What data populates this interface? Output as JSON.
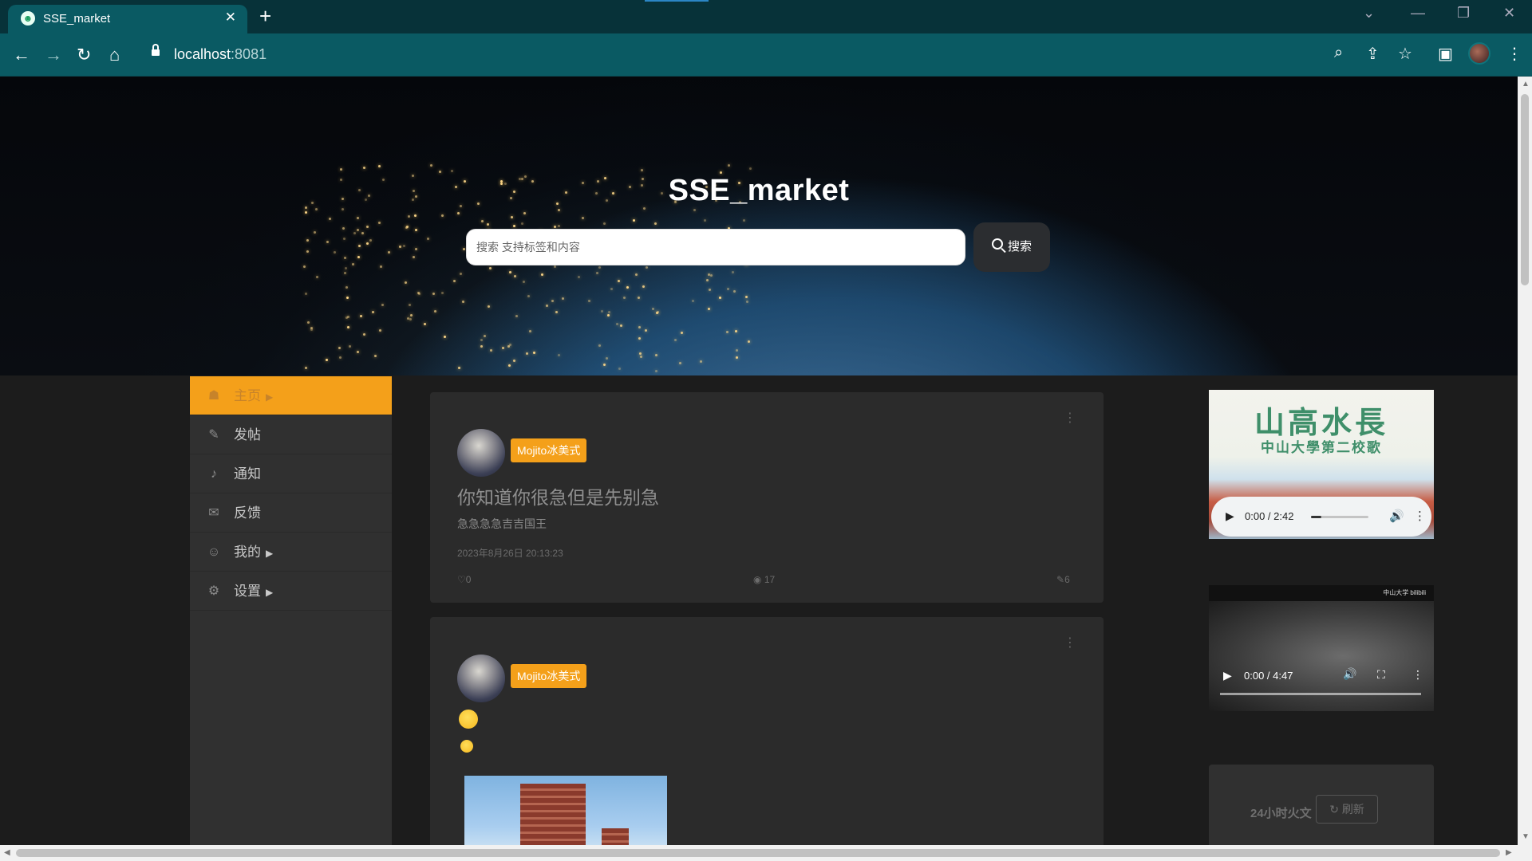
{
  "browser": {
    "tab_title": "SSE_market",
    "new_tab_label": "+",
    "close_tab_label": "✕",
    "url_host": "localhost",
    "url_port": ":8081",
    "icons": [
      "back-arrow-icon",
      "forward-arrow-icon",
      "reload-icon",
      "home-icon",
      "lock-icon",
      "zoom-icon",
      "share-icon",
      "star-icon",
      "sidepanel-icon",
      "profile-avatar",
      "menu-kebab-icon"
    ]
  },
  "hero": {
    "title": "SSE_market",
    "search_placeholder": "搜索  支持标签和内容",
    "search_button": "搜索"
  },
  "sidebar": {
    "items": [
      {
        "label": "主页",
        "icon": "home-icon",
        "has_caret": true,
        "active": true
      },
      {
        "label": "发帖",
        "icon": "pencil-icon",
        "has_caret": false
      },
      {
        "label": "通知",
        "icon": "bell-icon",
        "has_caret": false
      },
      {
        "label": "反馈",
        "icon": "envelope-icon",
        "has_caret": false
      },
      {
        "label": "我的",
        "icon": "user-circle-icon",
        "has_caret": true
      },
      {
        "label": "设置",
        "icon": "gear-icon",
        "has_caret": true
      }
    ],
    "active_color": "#f4a01a"
  },
  "posts": [
    {
      "username": "Mojito冰美式",
      "title": "你知道你很急但是先别急",
      "body": "急急急急吉吉国王",
      "date": "2023年8月26日 20:13:23",
      "likes": "0",
      "views": "17",
      "comments": "6"
    },
    {
      "username": "Mojito冰美式",
      "emojis": [
        "persevering-face-emoji",
        "hushed-face-emoji"
      ],
      "has_image": true
    }
  ],
  "right_column": {
    "audio": {
      "calligraphy": "山高水長",
      "subtitle": "中山大學第二校歌",
      "time": "0:00 / 2:42",
      "progress": 0.0
    },
    "video": {
      "watermark": "中山大学 bilibili",
      "time": "0:00 / 4:47",
      "progress": 0.0
    },
    "hot": {
      "title": "24小时火文",
      "refresh_label": "刷新"
    }
  },
  "colors": {
    "accent": "#f4a01a",
    "chrome_tab": "#0a5a63",
    "chrome_top": "#073239",
    "page_bg": "#1c1c1c",
    "card_bg": "#2b2b2b"
  }
}
